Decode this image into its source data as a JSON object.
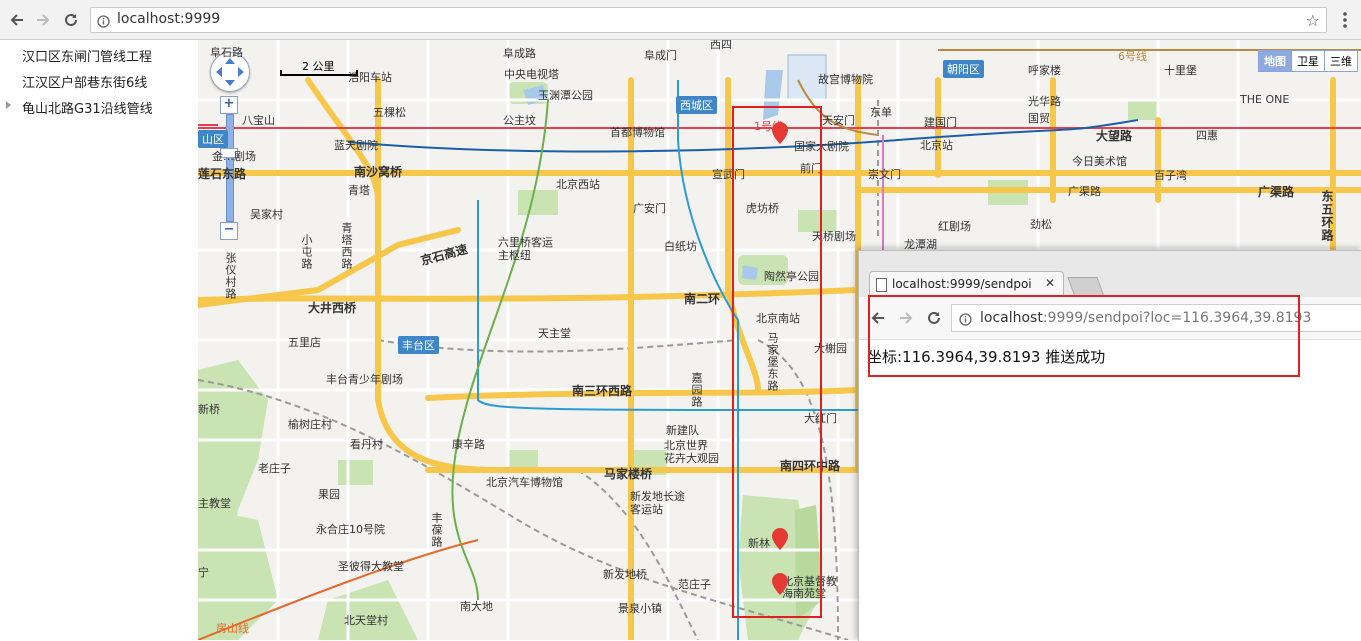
{
  "browser": {
    "url": "localhost:9999",
    "icons": [
      "back-arrow-icon",
      "forward-arrow-icon",
      "reload-icon",
      "info-icon",
      "star-icon",
      "menu-icon"
    ]
  },
  "tree": {
    "items": [
      {
        "label": "汉口区东闸门管线工程",
        "expandable": false
      },
      {
        "label": "江汉区户部巷东街6线",
        "expandable": false
      },
      {
        "label": "龟山北路G31沿线管线",
        "expandable": true
      }
    ]
  },
  "map": {
    "scale_label": "2 公里",
    "map_types": [
      "地图",
      "卫星",
      "三维"
    ],
    "selected_map_type": "地图",
    "districts": [
      "西城区",
      "朝阳区",
      "丰台区",
      "山区"
    ],
    "labels": {
      "l1": "阜石路",
      "l2": "阜成路",
      "l3": "阜成门",
      "l4": "西四",
      "l5": "中央电视塔",
      "l6": "玉渊潭公园",
      "l7": "五棵松",
      "l8": "公主坟",
      "l9": "八宝山",
      "l10": "首都博物馆",
      "l11": "蓝天剧院",
      "l12": "金…剧场",
      "l13": "南沙窝桥",
      "l14": "青塔",
      "l15": "北京西站",
      "l16": "宣武门",
      "l17": "前门",
      "l18": "崇文门",
      "l19": "广安门",
      "l20": "虎坊桥",
      "l21": "吴家村",
      "l22": "白纸坊",
      "l23": "天桥剧场",
      "l24": "京石高速",
      "l25": "六里桥客运",
      "l26": "主枢纽",
      "l27": "陶然亭公园",
      "l28": "南二环",
      "l29": "大井西桥",
      "l30": "北京南站",
      "l31": "天主堂",
      "l32": "五里店",
      "l33": "丰台青少年剧场",
      "l34": "南三环西路",
      "l35": "榆树庄村",
      "l36": "看丹村",
      "l37": "康辛路",
      "l38": "新建队",
      "l39": "北京世界",
      "l40": "花卉大观园",
      "l41": "老庄子",
      "l42": "马家楼桥",
      "l43": "北京汽车博物馆",
      "l44": "果园",
      "l45": "新发地长途",
      "l46": "客运站",
      "l47": "永合庄10号院",
      "l48": "圣彼得大教堂",
      "l49": "新发地桥",
      "l50": "范庄子",
      "l51": "南大地",
      "l52": "景泉小镇",
      "l53": "北天堂村",
      "l54": "房山线",
      "l55": "故宫博物院",
      "l56": "天安门",
      "l57": "国家大剧院",
      "l58": "东单",
      "l59": "建国门",
      "l60": "北京站",
      "l61": "呼家楼",
      "l62": "十里堡",
      "l63": "光华路",
      "l64": "国贸",
      "l65": "THE ONE",
      "l66": "大望路",
      "l67": "四惠",
      "l68": "今日美术馆",
      "l69": "广渠路",
      "l70": "百子湾",
      "l71": "广渠路",
      "l72": "红剧场",
      "l73": "劲松",
      "l74": "龙潭湖",
      "l75": "大红门",
      "l76": "南四环中路",
      "l77": "大榭园",
      "l78": "新林",
      "l79": "北京基督教",
      "l80": "海南苑堂",
      "l81": "1号线",
      "l82": "6号线",
      "l83": "浩阳车站",
      "l84": "新桥",
      "l85": "宁",
      "l86": "主教堂",
      "l87": "东五环路",
      "l88": "莲石东路"
    },
    "vlabels": {
      "v1": "青塔西路",
      "v2": "小屯路",
      "v3": "张仪村路",
      "v4": "马家堡东路",
      "v5": "嘉园路",
      "v6": "丰葆路"
    },
    "markers": [
      "marker-pin",
      "marker-pin",
      "marker-pin"
    ]
  },
  "popup": {
    "tab_title": "localhost:9999/sendpoi",
    "url_host": "localhost",
    "url_rest": ":9999/sendpoi?loc=116.3964,39.8193",
    "message": "坐标:116.3964,39.8193 推送成功"
  },
  "colors": {
    "highlight_red": "#e02020",
    "district_blue": "#3f86c7",
    "highway_yellow": "#f7c74b"
  }
}
